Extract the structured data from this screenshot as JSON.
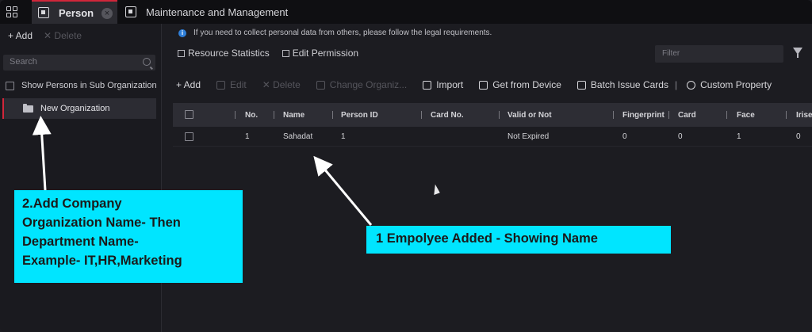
{
  "top_tabs": {
    "active": {
      "label": "Person",
      "close_symbol": "×"
    },
    "inactive": {
      "label": "Maintenance and Management"
    }
  },
  "left_panel": {
    "add_label": "+ Add",
    "delete_label": "✕ Delete",
    "search_placeholder": "Search",
    "show_sub_org_label": "Show Persons in Sub Organization",
    "org_item_label": "New Organization"
  },
  "notice": {
    "info_symbol": "i",
    "text": "If you need to collect personal data from others, please follow the legal requirements."
  },
  "sub_actions": {
    "resource_statistics": "Resource Statistics",
    "edit_permission": "Edit Permission"
  },
  "filter_placeholder": "Filter",
  "toolbar": {
    "add": "+ Add",
    "edit": "Edit",
    "delete": "✕ Delete",
    "change_org": "Change Organiz...",
    "import": "Import",
    "get_from_device": "Get from Device",
    "batch_issue_cards": "Batch Issue Cards",
    "separator": "|",
    "custom_property": "Custom Property"
  },
  "table": {
    "headers": [
      "No.",
      "Name",
      "Person ID",
      "Card No.",
      "Valid or Not",
      "Fingerprint",
      "Card",
      "Face",
      "Irise"
    ],
    "rows": [
      {
        "no": "1",
        "name": "Sahadat",
        "person_id": "1",
        "card_no": "",
        "valid": "Not Expired",
        "fingerprint": "0",
        "card": "0",
        "face": "1",
        "iris": "0"
      }
    ]
  },
  "annotations": {
    "left_line1": "2.Add Company",
    "left_line2": "Organization Name- Then",
    "left_line3": "Department Name-",
    "left_line4": "Example- IT,HR,Marketing",
    "right_text": "1 Empolyee Added - Showing Name"
  },
  "colors": {
    "accent_red": "#d1263a",
    "callout_cyan": "#00e5ff",
    "info_blue": "#2f7fd9"
  }
}
